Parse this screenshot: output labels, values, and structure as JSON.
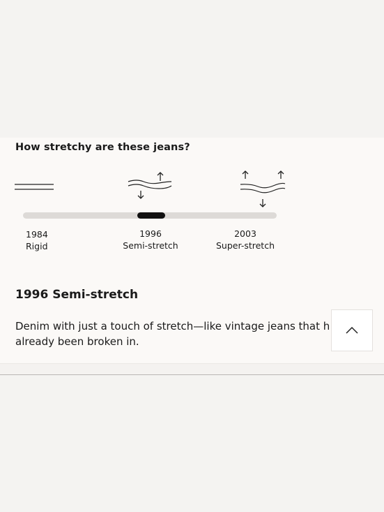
{
  "question": "How stretchy are these jeans?",
  "stretch_scale": {
    "stops": [
      {
        "year": "1984",
        "name": "Rigid",
        "icon": "flat-lines-icon"
      },
      {
        "year": "1996",
        "name": "Semi-stretch",
        "icon": "semi-stretch-icon"
      },
      {
        "year": "2003",
        "name": "Super-stretch",
        "icon": "super-stretch-icon"
      }
    ],
    "selected_index": 1
  },
  "detail": {
    "title": "1996 Semi-stretch",
    "line1": "Denim with just a touch of stretch—like vintage jeans that have",
    "line2": "already been broken in."
  },
  "scroll_top": {
    "icon": "chevron-up-icon"
  },
  "colors": {
    "track": "#dddad7",
    "thumb": "#111111",
    "panel": "#fbf9f7",
    "page": "#f4f3f1"
  }
}
